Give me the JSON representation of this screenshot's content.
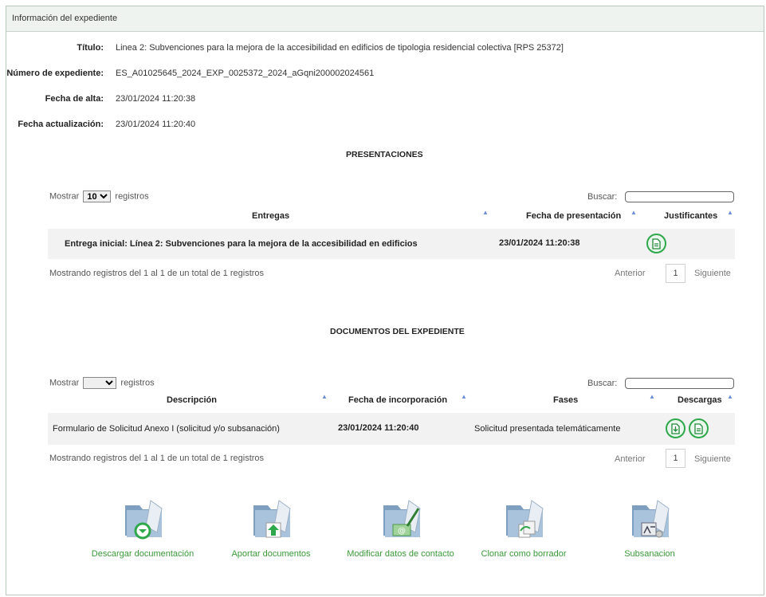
{
  "panel_title": "Información del expediente",
  "info": [
    {
      "label": "Título:",
      "value": "Linea 2: Subvenciones para la mejora de la accesibilidad en edificios de tipologia residencial colectiva [RPS 25372]"
    },
    {
      "label": "Número de expediente:",
      "value": "ES_A01025645_2024_EXP_0025372_2024_aGqni200002024561"
    },
    {
      "label": "Fecha de alta:",
      "value": "23/01/2024 11:20:38"
    },
    {
      "label": "Fecha actualización:",
      "value": "23/01/2024 11:20:40"
    }
  ],
  "presentaciones": {
    "title": "PRESENTACIONES",
    "show_prefix": "Mostrar",
    "show_value": "10",
    "show_suffix": "registros",
    "search_label": "Buscar:",
    "search_value": "",
    "columns": [
      "Entregas",
      "Fecha de presentación",
      "Justificantes"
    ],
    "rows": [
      {
        "entrega": "Entrega inicial: Línea 2: Subvenciones para la mejora de la accesibilidad en edificios",
        "fecha": "23/01/2024 11:20:38",
        "justificante_icon": "document-icon"
      }
    ],
    "summary": "Mostrando registros del 1 al 1 de un total de 1 registros",
    "prev": "Anterior",
    "page": "1",
    "next": "Siguiente"
  },
  "documentos": {
    "title": "DOCUMENTOS DEL EXPEDIENTE",
    "show_prefix": "Mostrar",
    "show_value": "",
    "show_suffix": "registros",
    "search_label": "Buscar:",
    "search_value": "",
    "columns": [
      "Descripción",
      "Fecha de incorporación",
      "Fases",
      "Descargas"
    ],
    "rows": [
      {
        "descripcion": "Formulario de Solicitud Anexo I (solicitud y/o subsanación)",
        "fecha": "23/01/2024 11:20:40",
        "fase": "Solicitud presentada telemáticamente",
        "download_icons": [
          "download-icon",
          "document-icon"
        ]
      }
    ],
    "summary": "Mostrando registros del 1 al 1 de un total de 1 registros",
    "prev": "Anterior",
    "page": "1",
    "next": "Siguiente"
  },
  "actions": [
    {
      "label": "Descargar documentación",
      "icon": "folder-download-icon"
    },
    {
      "label": "Aportar documentos",
      "icon": "folder-upload-icon"
    },
    {
      "label": "Modificar datos de contacto",
      "icon": "folder-email-icon"
    },
    {
      "label": "Clonar como borrador",
      "icon": "folder-clone-icon"
    },
    {
      "label": "Subsanacion",
      "icon": "folder-settings-icon"
    }
  ],
  "colors": {
    "accent_green": "#2ea84a",
    "sort_arrow": "#6b8fd6",
    "header_bg": "#eef3ef",
    "link_green": "#3a9a3a"
  }
}
